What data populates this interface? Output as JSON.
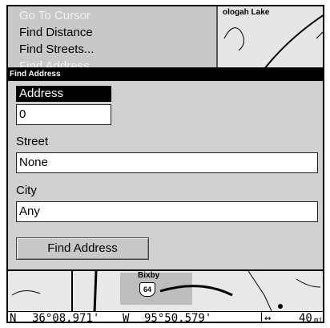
{
  "menu": {
    "items": [
      {
        "label": "Go To Cursor",
        "state": "disabled"
      },
      {
        "label": "Find Distance",
        "state": "normal"
      },
      {
        "label": "Find Streets...",
        "state": "normal"
      },
      {
        "label": "Find Address",
        "state": "partial"
      }
    ]
  },
  "map_top": {
    "lake_label": "ologah Lake"
  },
  "dialog": {
    "title": "Find Address",
    "fields": {
      "address": {
        "label": "Address",
        "value": "0"
      },
      "street": {
        "label": "Street",
        "value": "None"
      },
      "city": {
        "label": "City",
        "value": "Any"
      }
    },
    "button_label": "Find Address"
  },
  "map_bottom": {
    "town_label": "Bixby",
    "route_shield": "64"
  },
  "status": {
    "lat_hemi": "N",
    "lat": "36°08.971'",
    "lon_hemi": "W",
    "lon": "95°50.579'",
    "zoom_icon": "↔",
    "zoom_value": "40",
    "zoom_unit": "mi"
  }
}
